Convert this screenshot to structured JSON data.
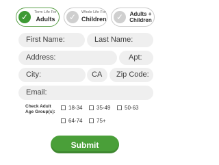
{
  "tabs": [
    {
      "small": "Term Life For",
      "big": "Adults",
      "active": true
    },
    {
      "small": "Whole Life For",
      "big": "Children",
      "active": false
    },
    {
      "line1": "Adults +",
      "line2": "Children",
      "active": false
    }
  ],
  "form": {
    "first_name_placeholder": "First Name:",
    "last_name_placeholder": "Last Name:",
    "address_placeholder": "Address:",
    "apt_placeholder": "Apt:",
    "city_placeholder": "City:",
    "state_value": "CA",
    "zip_placeholder": "Zip Code:",
    "email_placeholder": "Email:"
  },
  "age_groups": {
    "label": "Check Adult Age Group(s):",
    "options": [
      "18-34",
      "35-49",
      "50-63",
      "64-74",
      "75+"
    ]
  },
  "submit_label": "Submit",
  "colors": {
    "accent": "#3e9a34",
    "button": "#4a9f39",
    "field_bg": "#efefef"
  }
}
